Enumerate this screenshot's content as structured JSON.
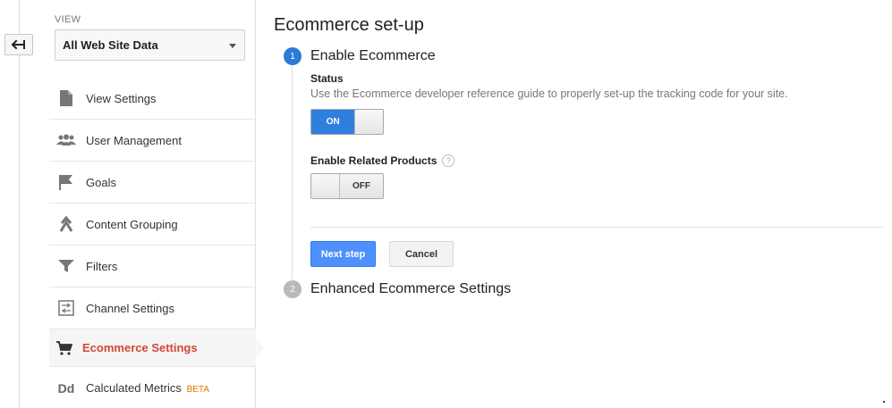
{
  "sidebar": {
    "view_label": "VIEW",
    "view_selected": "All Web Site Data",
    "items": [
      {
        "label": "View Settings",
        "icon": "document-icon"
      },
      {
        "label": "User Management",
        "icon": "users-icon"
      },
      {
        "label": "Goals",
        "icon": "flag-icon"
      },
      {
        "label": "Content Grouping",
        "icon": "content-grouping-icon"
      },
      {
        "label": "Filters",
        "icon": "filter-icon"
      },
      {
        "label": "Channel Settings",
        "icon": "channel-settings-icon"
      },
      {
        "label": "Ecommerce Settings",
        "icon": "cart-icon"
      },
      {
        "label": "Calculated Metrics",
        "icon": "dd-icon",
        "badge": "BETA",
        "icon_text": "Dd"
      }
    ]
  },
  "main": {
    "title": "Ecommerce set-up",
    "step1": {
      "number": "1",
      "title": "Enable Ecommerce",
      "status_label": "Status",
      "status_desc": "Use the Ecommerce developer reference guide to properly set-up the tracking code for your site.",
      "status_toggle": "ON",
      "related_label": "Enable Related Products",
      "help": "?",
      "related_toggle": "OFF",
      "next_label": "Next step",
      "cancel_label": "Cancel"
    },
    "step2": {
      "number": "2",
      "title": "Enhanced Ecommerce Settings"
    }
  },
  "colors": {
    "accent_blue": "#2f7fde",
    "button_blue": "#4d90fe",
    "active_red": "#d14836",
    "beta_orange": "#e37400"
  }
}
